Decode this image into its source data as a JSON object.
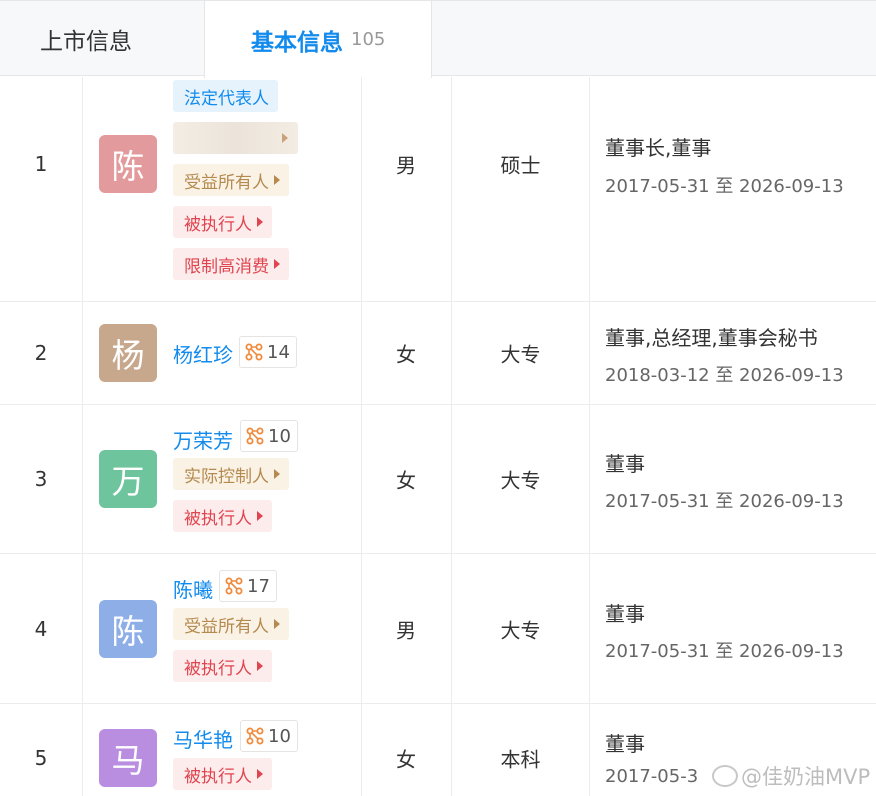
{
  "tabs": [
    {
      "label": "上市信息"
    },
    {
      "label": "基本信息",
      "count": "105"
    }
  ],
  "colors": {
    "accent": "#128bed",
    "tag_red": "#e0444f",
    "tag_tan": "#b48a4e"
  },
  "rows": [
    {
      "index": "1",
      "avatar_char": "陈",
      "avatar_color": "#e39a9c",
      "name": "",
      "tags": [
        "法定代表人",
        "",
        "受益所有人",
        "被执行人",
        "限制高消费"
      ],
      "gender": "男",
      "education": "硕士",
      "position": "董事长,董事",
      "term": "2017-05-31 至 2026-09-13"
    },
    {
      "index": "2",
      "avatar_char": "杨",
      "avatar_color": "#c7a88c",
      "name": "杨红珍",
      "relations": "14",
      "gender": "女",
      "education": "大专",
      "position": "董事,总经理,董事会秘书",
      "term": "2018-03-12 至 2026-09-13"
    },
    {
      "index": "3",
      "avatar_char": "万",
      "avatar_color": "#6ec49c",
      "name": "万荣芳",
      "relations": "10",
      "tags": [
        "实际控制人",
        "被执行人"
      ],
      "gender": "女",
      "education": "大专",
      "position": "董事",
      "term": "2017-05-31 至 2026-09-13"
    },
    {
      "index": "4",
      "avatar_char": "陈",
      "avatar_color": "#8eaee8",
      "name": "陈曦",
      "relations": "17",
      "tags": [
        "受益所有人",
        "被执行人"
      ],
      "gender": "男",
      "education": "大专",
      "position": "董事",
      "term": "2017-05-31 至 2026-09-13"
    },
    {
      "index": "5",
      "avatar_char": "马",
      "avatar_color": "#b98ee0",
      "name": "马华艳",
      "relations": "10",
      "tags": [
        "被执行人"
      ],
      "gender": "女",
      "education": "本科",
      "position": "董事",
      "term": "2017-05-3"
    }
  ],
  "watermark": "@佳奶油MVP"
}
